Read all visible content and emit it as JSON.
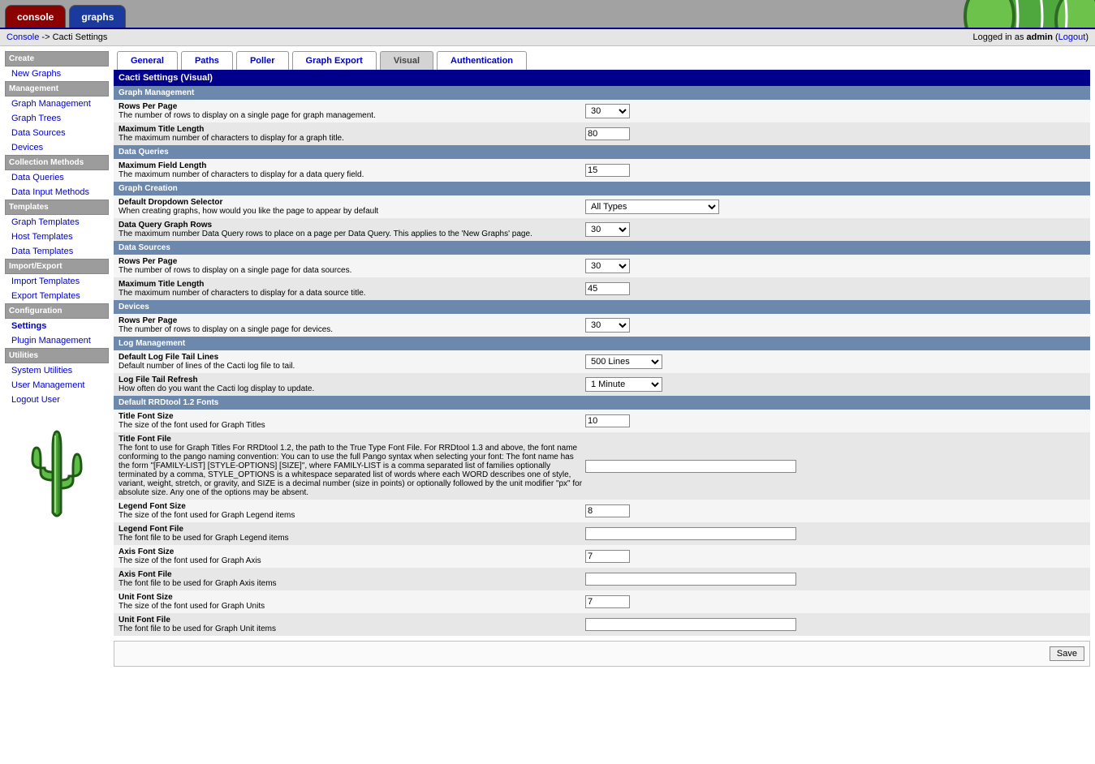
{
  "topbar": {
    "console_label": "console",
    "graphs_label": "graphs"
  },
  "breadcrumb": {
    "console_link": "Console",
    "separator": " -> ",
    "page": "Cacti Settings",
    "logged_in_prefix": "Logged in as ",
    "user": "admin",
    "logout_label": "Logout"
  },
  "sidebar": {
    "sections": [
      {
        "header": "Create",
        "links": [
          {
            "label": "New Graphs"
          }
        ]
      },
      {
        "header": "Management",
        "links": [
          {
            "label": "Graph Management"
          },
          {
            "label": "Graph Trees"
          },
          {
            "label": "Data Sources"
          },
          {
            "label": "Devices"
          }
        ]
      },
      {
        "header": "Collection Methods",
        "links": [
          {
            "label": "Data Queries"
          },
          {
            "label": "Data Input Methods"
          }
        ]
      },
      {
        "header": "Templates",
        "links": [
          {
            "label": "Graph Templates"
          },
          {
            "label": "Host Templates"
          },
          {
            "label": "Data Templates"
          }
        ]
      },
      {
        "header": "Import/Export",
        "links": [
          {
            "label": "Import Templates"
          },
          {
            "label": "Export Templates"
          }
        ]
      },
      {
        "header": "Configuration",
        "links": [
          {
            "label": "Settings",
            "active": true
          },
          {
            "label": "Plugin Management"
          }
        ]
      },
      {
        "header": "Utilities",
        "links": [
          {
            "label": "System Utilities"
          },
          {
            "label": "User Management"
          },
          {
            "label": "Logout User"
          }
        ]
      }
    ]
  },
  "tabs": [
    {
      "label": "General"
    },
    {
      "label": "Paths"
    },
    {
      "label": "Poller"
    },
    {
      "label": "Graph Export"
    },
    {
      "label": "Visual",
      "active": true
    },
    {
      "label": "Authentication"
    }
  ],
  "page_title": "Cacti Settings (Visual)",
  "sections": [
    {
      "header": "Graph Management",
      "rows": [
        {
          "title": "Rows Per Page",
          "desc": "The number of rows to display on a single page for graph management.",
          "type": "select",
          "cls": "small",
          "value": "30"
        },
        {
          "title": "Maximum Title Length",
          "desc": "The maximum number of characters to display for a graph title.",
          "type": "text",
          "cls": "small",
          "value": "80"
        }
      ]
    },
    {
      "header": "Data Queries",
      "rows": [
        {
          "title": "Maximum Field Length",
          "desc": "The maximum number of characters to display for a data query field.",
          "type": "text",
          "cls": "small",
          "value": "15"
        }
      ]
    },
    {
      "header": "Graph Creation",
      "rows": [
        {
          "title": "Default Dropdown Selector",
          "desc": "When creating graphs, how would you like the page to appear by default",
          "type": "select",
          "cls": "wide",
          "value": "All Types"
        },
        {
          "title": "Data Query Graph Rows",
          "desc": "The maximum number Data Query rows to place on a page per Data Query. This applies to the 'New Graphs' page.",
          "type": "select",
          "cls": "small",
          "value": "30"
        }
      ]
    },
    {
      "header": "Data Sources",
      "rows": [
        {
          "title": "Rows Per Page",
          "desc": "The number of rows to display on a single page for data sources.",
          "type": "select",
          "cls": "small",
          "value": "30"
        },
        {
          "title": "Maximum Title Length",
          "desc": "The maximum number of characters to display for a data source title.",
          "type": "text",
          "cls": "small",
          "value": "45"
        }
      ]
    },
    {
      "header": "Devices",
      "rows": [
        {
          "title": "Rows Per Page",
          "desc": "The number of rows to display on a single page for devices.",
          "type": "select",
          "cls": "small",
          "value": "30"
        }
      ]
    },
    {
      "header": "Log Management",
      "rows": [
        {
          "title": "Default Log File Tail Lines",
          "desc": "Default number of lines of the Cacti log file to tail.",
          "type": "select",
          "cls": "medium",
          "value": "500 Lines"
        },
        {
          "title": "Log File Tail Refresh",
          "desc": "How often do you want the Cacti log display to update.",
          "type": "select",
          "cls": "medium",
          "value": "1 Minute"
        }
      ]
    },
    {
      "header": "Default RRDtool 1.2 Fonts",
      "rows": [
        {
          "title": "Title Font Size",
          "desc": "The size of the font used for Graph Titles",
          "type": "text",
          "cls": "small",
          "value": "10"
        },
        {
          "title": "Title Font File",
          "desc": "The font to use for Graph Titles\nFor RRDtool 1.2, the path to the True Type Font File.\nFor RRDtool 1.3 and above, the font name conforming to the pango naming convention:\nYou can to use the full Pango syntax when selecting your font: The font name has the form \"[FAMILY-LIST] [STYLE-OPTIONS] [SIZE]\", where FAMILY-LIST is a comma separated list of families optionally terminated by a comma, STYLE_OPTIONS is a whitespace separated list of words where each WORD describes one of style, variant, weight, stretch, or gravity, and SIZE is a decimal number (size in points) or optionally followed by the unit modifier \"px\" for absolute size. Any one of the options may be absent.",
          "type": "text",
          "cls": "wide",
          "value": ""
        },
        {
          "title": "Legend Font Size",
          "desc": "The size of the font used for Graph Legend items",
          "type": "text",
          "cls": "small",
          "value": "8"
        },
        {
          "title": "Legend Font File",
          "desc": "The font file to be used for Graph Legend items",
          "type": "text",
          "cls": "wide",
          "value": ""
        },
        {
          "title": "Axis Font Size",
          "desc": "The size of the font used for Graph Axis",
          "type": "text",
          "cls": "small",
          "value": "7"
        },
        {
          "title": "Axis Font File",
          "desc": "The font file to be used for Graph Axis items",
          "type": "text",
          "cls": "wide",
          "value": ""
        },
        {
          "title": "Unit Font Size",
          "desc": "The size of the font used for Graph Units",
          "type": "text",
          "cls": "small",
          "value": "7"
        },
        {
          "title": "Unit Font File",
          "desc": "The font file to be used for Graph Unit items",
          "type": "text",
          "cls": "wide",
          "value": ""
        }
      ]
    }
  ],
  "save_label": "Save"
}
